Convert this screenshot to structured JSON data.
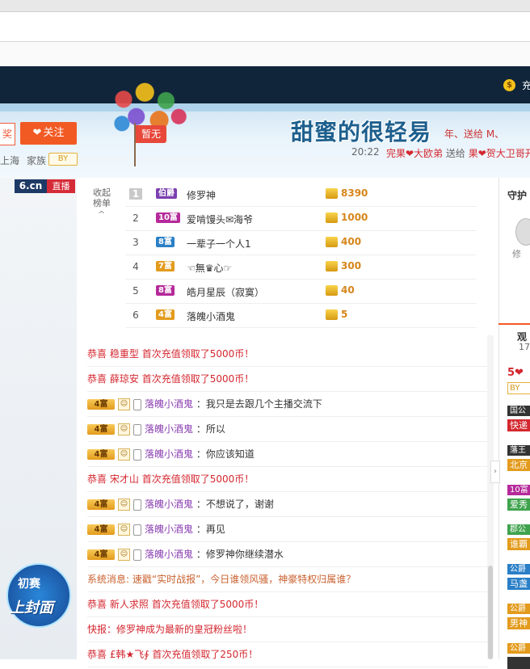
{
  "top_nav": {
    "coin_glyph": "$",
    "text": "充"
  },
  "banner": {
    "tag_none": "暂无",
    "follow_left": "奖",
    "follow_button": "关注",
    "location": "上海",
    "family_label": "家族",
    "family_badge": "BY",
    "room_title": "甜蜜的很轻易",
    "ticker_line1": "年、送给 M、",
    "time": "20:22",
    "ticker2_sender": "完果❤大欧弟",
    "ticker2_verb": "送给",
    "ticker2_receiver": "果❤贺大卫哥开"
  },
  "video": {
    "logo": "6.cn",
    "live": "直播",
    "cover_line1": "初赛",
    "cover_line2": "上封面"
  },
  "rank": {
    "collapse_label": "收起榜单",
    "collapse_icon": "^",
    "rows": [
      {
        "rank": "1",
        "level": "伯爵",
        "name": "修罗神",
        "value": "8390",
        "color": "#7a3fb0"
      },
      {
        "rank": "2",
        "level": "10富",
        "name": "爱啃馒头✉海爷",
        "value": "1000",
        "color": "#b52a9a"
      },
      {
        "rank": "3",
        "level": "8富",
        "name": "一辈子一个人1",
        "value": "400",
        "color": "#2a7fc7"
      },
      {
        "rank": "4",
        "level": "7富",
        "name": "☜無♛心☞",
        "value": "300",
        "color": "#e39b1d"
      },
      {
        "rank": "5",
        "level": "8富",
        "name": "皓月星辰（寂寞）",
        "value": "40",
        "color": "#b52a9a"
      },
      {
        "rank": "6",
        "level": "4富",
        "name": "落魄小酒鬼",
        "value": "5",
        "color": "#e39b1d"
      }
    ]
  },
  "chat": {
    "messages": [
      {
        "type": "system",
        "prefix": "恭喜",
        "name": "稳重型",
        "text": "首次充值领取了5000币！"
      },
      {
        "type": "system",
        "prefix": "恭喜",
        "name": "薛琼安",
        "text": "首次充值领取了5000币！"
      },
      {
        "type": "user",
        "level": "4富",
        "name": "落魄小酒鬼",
        "text": "：我只是去跟几个主播交流下"
      },
      {
        "type": "user",
        "level": "4富",
        "name": "落魄小酒鬼",
        "text": "：所以"
      },
      {
        "type": "user",
        "level": "4富",
        "name": "落魄小酒鬼",
        "text": "：你应该知道"
      },
      {
        "type": "system",
        "prefix": "恭喜",
        "name": "宋才山",
        "text": "首次充值领取了5000币！"
      },
      {
        "type": "user",
        "level": "4富",
        "name": "落魄小酒鬼",
        "text": "：不想说了，谢谢"
      },
      {
        "type": "user",
        "level": "4富",
        "name": "落魄小酒鬼",
        "text": "：再见"
      },
      {
        "type": "user",
        "level": "4富",
        "name": "落魄小酒鬼",
        "text": "：修罗神你继续潜水"
      },
      {
        "type": "notice",
        "text": "系统消息: 速戳“实时战报”，今日谁领风骚，神豪特权归属谁？"
      },
      {
        "type": "system",
        "prefix": "恭喜",
        "name": "新人求照",
        "text": "首次充值领取了5000币！"
      },
      {
        "type": "news",
        "prefix": "快报：",
        "name": "修罗神",
        "text": "成为最新的皇冠粉丝啦！"
      },
      {
        "type": "system",
        "prefix": "恭喜",
        "name": "£韩★飞∮",
        "text": "首次充值领取了250币！"
      }
    ]
  },
  "right": {
    "guard_title": "守护",
    "guard_name": "修",
    "audience_tab": "观",
    "audience_count": "17",
    "aud_level": "5",
    "aud_badge_by": "BY",
    "toggle": "›",
    "entries": [
      {
        "badge": "国公",
        "name": "快递",
        "badge_color": "#333",
        "name_color": "#d4272f"
      },
      {
        "badge": "藩王",
        "name": "北京",
        "badge_color": "#333",
        "name_color": "#e39b1d"
      },
      {
        "badge": "10富",
        "name": "爱秀",
        "badge_color": "#b52a9a",
        "name_color": "#3fa34d"
      },
      {
        "badge": "郡公",
        "name": "谁覇",
        "badge_color": "#3fa34d",
        "name_color": "#e39b1d"
      },
      {
        "badge": "公爵",
        "name": "马盏",
        "badge_color": "#2a7fc7",
        "name_color": "#2a7fc7"
      },
      {
        "badge": "公爵",
        "name": "男神",
        "badge_color": "#e39b1d",
        "name_color": "#e39b1d"
      },
      {
        "badge": "公爵",
        "name": "",
        "badge_color": "#e39b1d",
        "name_color": "#333"
      }
    ]
  }
}
